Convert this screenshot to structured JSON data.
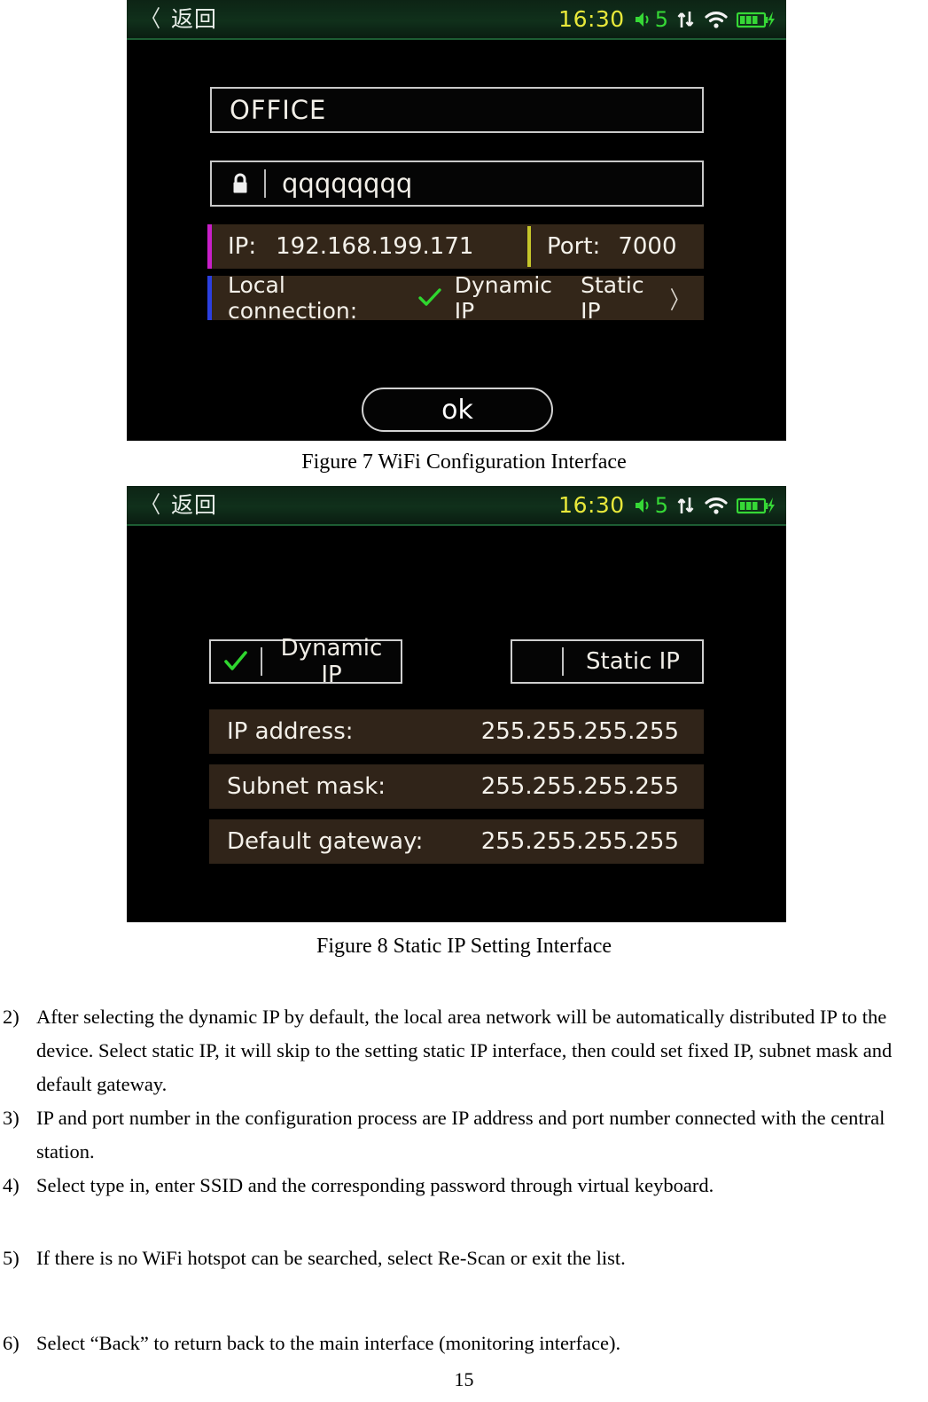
{
  "document": {
    "page_number": "15"
  },
  "figure7": {
    "caption": "Figure 7 WiFi Configuration Interface",
    "statusbar": {
      "back_chevron": "〈",
      "back_label": "返回",
      "clock": "16:30",
      "volume_level": "5",
      "volume_icon": "speaker-icon",
      "data_icon": "up-down-arrows-icon",
      "wifi_icon": "wifi-icon",
      "battery_icon": "battery-charging-icon",
      "clock_color": "#e8e83a",
      "accent_green": "#36d836"
    },
    "ssid": {
      "value": "OFFICE"
    },
    "password": {
      "lock_icon": "lock-icon",
      "value": "qqqqqqqq"
    },
    "ip_row": {
      "ip_label": "IP:",
      "ip_value": "192.168.199.171",
      "port_label": "Port:",
      "port_value": "7000",
      "accent_color": "#c81fc8",
      "divider_color": "#c5c52a"
    },
    "local_row": {
      "label": "Local connection:",
      "check_icon": "check-icon",
      "dynamic_label": "Dynamic IP",
      "static_label": "Static IP",
      "chevron": "〉",
      "accent_color": "#2b3fe0"
    },
    "ok_button": {
      "label": "ok"
    }
  },
  "figure8": {
    "caption": "Figure 8 Static IP Setting Interface",
    "statusbar": {
      "back_chevron": "〈",
      "back_label": "返回",
      "clock": "16:30",
      "volume_level": "5",
      "volume_icon": "speaker-icon",
      "data_icon": "up-down-arrows-icon",
      "wifi_icon": "wifi-icon",
      "battery_icon": "battery-charging-icon"
    },
    "dynamic_button": {
      "label": "Dynamic IP",
      "check_icon": "check-icon",
      "selected": true
    },
    "static_button": {
      "label": "Static IP",
      "selected": false
    },
    "rows": [
      {
        "label": "IP address:",
        "value": "255.255.255.255"
      },
      {
        "label": "Subnet mask:",
        "value": "255.255.255.255"
      },
      {
        "label": "Default gateway:",
        "value": "255.255.255.255"
      }
    ]
  },
  "notes": [
    {
      "num": "2)",
      "text": "After selecting the dynamic IP by default, the local area network will be automatically distributed IP to the device. Select static IP, it will skip to the setting static IP interface, then could set fixed IP, subnet mask and default gateway."
    },
    {
      "num": "3)",
      "text": "IP and port number in the configuration process are IP address and port number connected with the central station."
    },
    {
      "num": "4)",
      "text": "Select type in, enter SSID and the corresponding password through virtual keyboard."
    },
    {
      "num": "5)",
      "text": "If there is no WiFi hotspot can be searched, select Re-Scan or exit the list."
    },
    {
      "num": "6)",
      "text": "Select “Back” to return back to the main interface (monitoring interface)."
    }
  ]
}
